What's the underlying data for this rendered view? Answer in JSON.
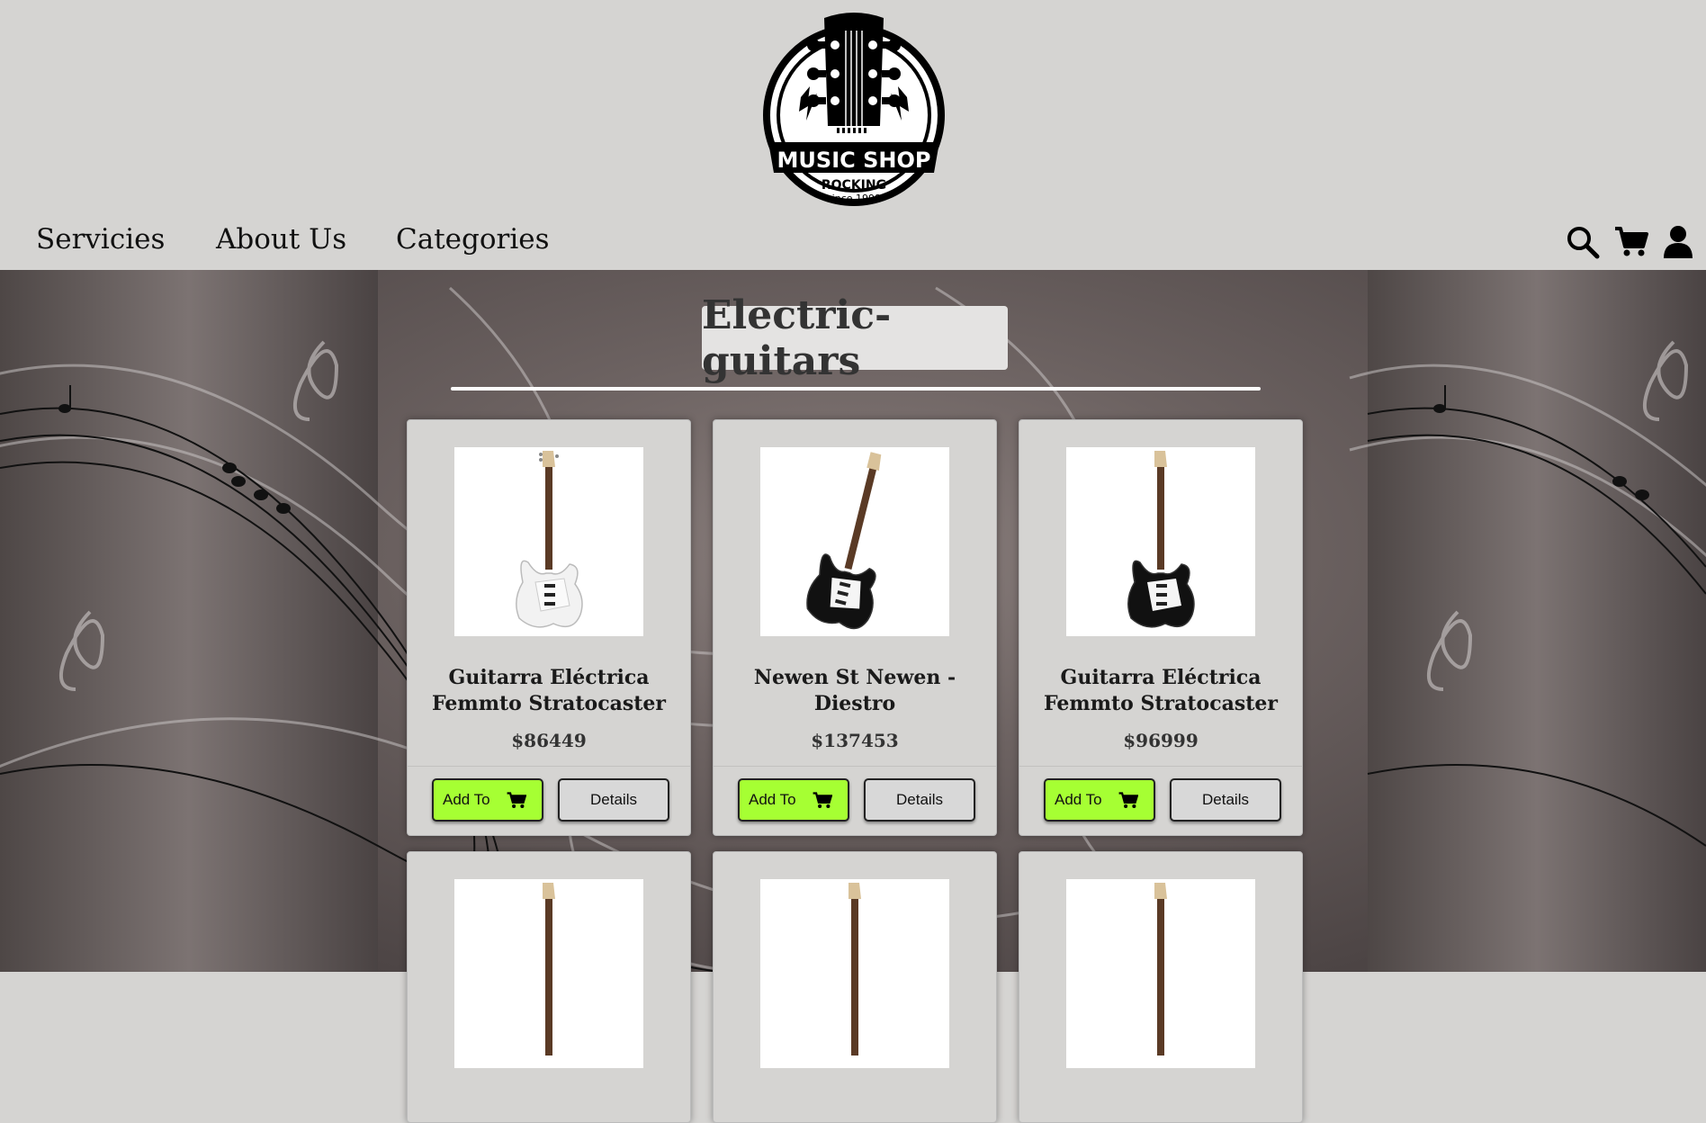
{
  "logo": {
    "brand": "MUSIC SHOP",
    "tagline": "ROCKING",
    "since": "since 1998"
  },
  "nav": {
    "items": [
      "Servicies",
      "About Us",
      "Categories"
    ]
  },
  "icons": [
    "search-icon",
    "cart-icon",
    "user-icon"
  ],
  "page": {
    "title": "Electric-guitars"
  },
  "colors": {
    "add_button": "#a6ff33",
    "header_bg": "#d5d4d2",
    "card_bg": "#d5d4d2"
  },
  "products": [
    {
      "name": "Guitarra Eléctrica Femmto Stratocaster",
      "price": "$86449",
      "add_label": "Add To",
      "details_label": "Details",
      "body_color": "#f2f2f2"
    },
    {
      "name": "Newen St Newen - Diestro",
      "price": "$137453",
      "add_label": "Add To",
      "details_label": "Details",
      "body_color": "#111111"
    },
    {
      "name": "Guitarra Eléctrica Femmto Stratocaster",
      "price": "$96999",
      "add_label": "Add To",
      "details_label": "Details",
      "body_color": "#111111"
    }
  ]
}
